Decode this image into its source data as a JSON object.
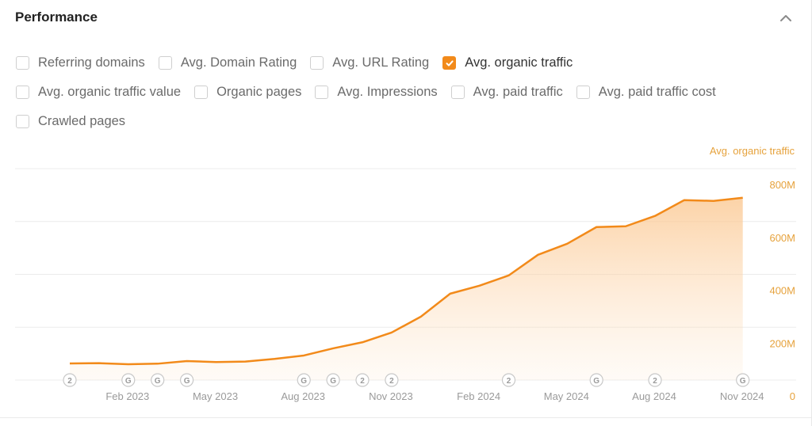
{
  "panel": {
    "title": "Performance",
    "collapse_icon": "chevron-up-icon"
  },
  "metrics": {
    "rows": [
      [
        {
          "label": "Referring domains",
          "checked": false
        },
        {
          "label": "Avg. Domain Rating",
          "checked": false
        },
        {
          "label": "Avg. URL Rating",
          "checked": false
        },
        {
          "label": "Avg. organic traffic",
          "checked": true
        }
      ],
      [
        {
          "label": "Avg. organic traffic value",
          "checked": false
        },
        {
          "label": "Organic pages",
          "checked": false
        },
        {
          "label": "Avg. Impressions",
          "checked": false
        },
        {
          "label": "Avg. paid traffic",
          "checked": false
        },
        {
          "label": "Avg. paid traffic cost",
          "checked": false
        }
      ],
      [
        {
          "label": "Crawled pages",
          "checked": false
        }
      ]
    ]
  },
  "colors": {
    "accent": "#f28a1a",
    "axis_label": "#e6a23c",
    "grid": "#ececec",
    "tick_text": "#9a9a9a"
  },
  "chart_data": {
    "type": "area",
    "title": "",
    "legend": [
      {
        "name": "Avg. organic traffic",
        "placement": "top-right"
      }
    ],
    "ylabel": "Avg. organic traffic",
    "ylim": [
      0,
      800000000
    ],
    "yticks": [
      {
        "value": 0,
        "label": "0"
      },
      {
        "value": 200000000,
        "label": "200M"
      },
      {
        "value": 400000000,
        "label": "400M"
      },
      {
        "value": 600000000,
        "label": "600M"
      },
      {
        "value": 800000000,
        "label": "800M"
      }
    ],
    "grid": true,
    "xticks": [
      {
        "index": 2,
        "label": "Feb 2023"
      },
      {
        "index": 5,
        "label": "May 2023"
      },
      {
        "index": 8,
        "label": "Aug 2023"
      },
      {
        "index": 11,
        "label": "Nov 2023"
      },
      {
        "index": 14,
        "label": "Feb 2024"
      },
      {
        "index": 17,
        "label": "May 2024"
      },
      {
        "index": 20,
        "label": "Aug 2024"
      },
      {
        "index": 23,
        "label": "Nov 2024"
      }
    ],
    "x": [
      "Dec 2022",
      "Jan 2023",
      "Feb 2023",
      "Mar 2023",
      "Apr 2023",
      "May 2023",
      "Jun 2023",
      "Jul 2023",
      "Aug 2023",
      "Sep 2023",
      "Oct 2023",
      "Nov 2023",
      "Dec 2023",
      "Jan 2024",
      "Feb 2024",
      "Mar 2024",
      "Apr 2024",
      "May 2024",
      "Jun 2024",
      "Jul 2024",
      "Aug 2024",
      "Sep 2024",
      "Oct 2024",
      "Nov 2024"
    ],
    "series": [
      {
        "name": "Avg. organic traffic",
        "values": [
          63000000,
          64000000,
          60000000,
          62000000,
          72000000,
          68000000,
          70000000,
          80000000,
          93000000,
          120000000,
          143000000,
          180000000,
          240000000,
          327000000,
          357000000,
          396000000,
          474000000,
          516000000,
          579000000,
          582000000,
          621000000,
          681000000,
          678000000,
          690000000
        ]
      }
    ],
    "annotations": [
      {
        "index": 0,
        "label": "2"
      },
      {
        "index": 2,
        "label": "G"
      },
      {
        "index": 3,
        "label": "G"
      },
      {
        "index": 4,
        "label": "G"
      },
      {
        "index": 8,
        "label": "G"
      },
      {
        "index": 9,
        "label": "G"
      },
      {
        "index": 10,
        "label": "2"
      },
      {
        "index": 11,
        "label": "2"
      },
      {
        "index": 15,
        "label": "2"
      },
      {
        "index": 18,
        "label": "G"
      },
      {
        "index": 20,
        "label": "2"
      },
      {
        "index": 23,
        "label": "G"
      }
    ]
  }
}
